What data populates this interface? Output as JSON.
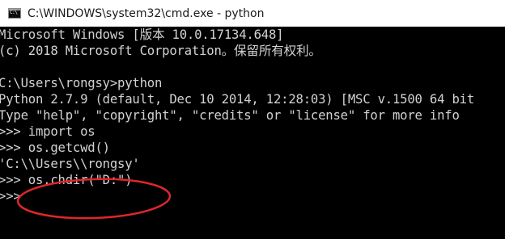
{
  "window": {
    "title": "C:\\WINDOWS\\system32\\cmd.exe - python",
    "icon": "cmd-icon",
    "icon_text": "C:\\"
  },
  "console": {
    "lines": [
      "Microsoft Windows [版本 10.0.17134.648]",
      "(c) 2018 Microsoft Corporation。保留所有权利。",
      "",
      "C:\\Users\\rongsy>python",
      "Python 2.7.9 (default, Dec 10 2014, 12:28:03) [MSC v.1500 64 bit",
      "Type \"help\", \"copyright\", \"credits\" or \"license\" for more info",
      ">>> import os",
      ">>> os.getcwd()",
      "'C:\\\\Users\\\\rongsy'",
      ">>> os.chdir(\"D:\")",
      ">>>"
    ]
  },
  "colors": {
    "console_background": "#000000",
    "console_text": "#d2d2d2",
    "annotation": "#e0262a"
  }
}
